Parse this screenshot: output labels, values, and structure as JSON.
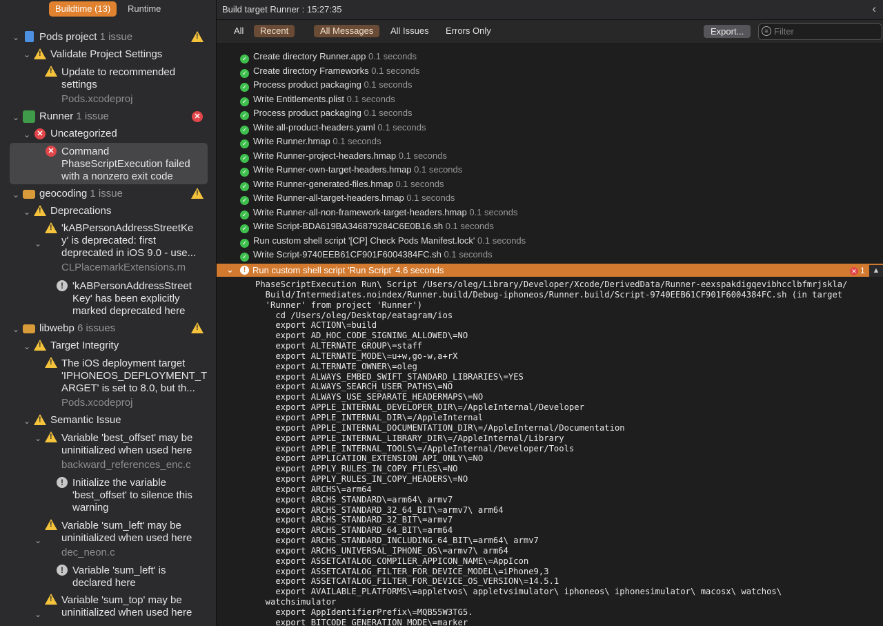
{
  "left_tabs": {
    "buildtime": "Buildtime (13)",
    "runtime": "Runtime"
  },
  "issues": {
    "pods_project": {
      "title": "Pods project",
      "count": "1 issue"
    },
    "validate_settings": "Validate Project Settings",
    "update_recommended": {
      "line1": "Update to recommended",
      "line2": "settings",
      "file": "Pods.xcodeproj"
    },
    "runner": {
      "title": "Runner",
      "count": "1 issue"
    },
    "uncategorized": "Uncategorized",
    "command_failed": {
      "line1": "Command",
      "line2": "PhaseScriptExecution failed",
      "line3": "with a nonzero exit code"
    },
    "geocoding": {
      "title": "geocoding",
      "count": "1 issue"
    },
    "deprecations": "Deprecations",
    "kab_deprecated": {
      "line1": "'kABPersonAddressStreetKe",
      "line2": "y' is deprecated: first",
      "line3": "deprecated in iOS 9.0 - use...",
      "file": "CLPlacemarkExtensions.m"
    },
    "kab_note": {
      "line1": "'kABPersonAddressStreet",
      "line2": "Key' has been explicitly",
      "line3": "marked deprecated here"
    },
    "libwebp": {
      "title": "libwebp",
      "count": "6 issues"
    },
    "target_integrity": "Target Integrity",
    "ios_deployment": {
      "line1": "The iOS deployment target",
      "line2": "'IPHONEOS_DEPLOYMENT_T",
      "line3": "ARGET' is set to 8.0, but th...",
      "file": "Pods.xcodeproj"
    },
    "semantic_issue": "Semantic Issue",
    "best_offset": {
      "line1": "Variable 'best_offset' may be",
      "line2": "uninitialized when used here",
      "file": "backward_references_enc.c"
    },
    "best_offset_note": {
      "line1": "Initialize the variable",
      "line2": "'best_offset' to silence this",
      "line3": "warning"
    },
    "sum_left": {
      "line1": "Variable 'sum_left' may be",
      "line2": "uninitialized when used here",
      "file": "dec_neon.c"
    },
    "sum_left_note": {
      "line1": "Variable 'sum_left' is",
      "line2": "declared here"
    },
    "sum_top": {
      "line1": "Variable 'sum_top' may be",
      "line2": "uninitialized when used here"
    }
  },
  "header": {
    "title": "Build target Runner : 15:27:35"
  },
  "toolbar": {
    "all": "All",
    "recent": "Recent",
    "all_messages": "All Messages",
    "all_issues": "All Issues",
    "errors_only": "Errors Only",
    "export": "Export...",
    "filter_placeholder": "Filter"
  },
  "log_rows": [
    {
      "text": "Create directory Runner.app",
      "dur": "0.1 seconds"
    },
    {
      "text": "Create directory Frameworks",
      "dur": "0.1 seconds"
    },
    {
      "text": "Process product packaging",
      "dur": "0.1 seconds"
    },
    {
      "text": "Write Entitlements.plist",
      "dur": "0.1 seconds"
    },
    {
      "text": "Process product packaging",
      "dur": "0.1 seconds"
    },
    {
      "text": "Write all-product-headers.yaml",
      "dur": "0.1 seconds"
    },
    {
      "text": "Write Runner.hmap",
      "dur": "0.1 seconds"
    },
    {
      "text": "Write Runner-project-headers.hmap",
      "dur": "0.1 seconds"
    },
    {
      "text": "Write Runner-own-target-headers.hmap",
      "dur": "0.1 seconds"
    },
    {
      "text": "Write Runner-generated-files.hmap",
      "dur": "0.1 seconds"
    },
    {
      "text": "Write Runner-all-target-headers.hmap",
      "dur": "0.1 seconds"
    },
    {
      "text": "Write Runner-all-non-framework-target-headers.hmap",
      "dur": "0.1 seconds"
    },
    {
      "text": "Write Script-BDA619BA346879284C6E0B16.sh",
      "dur": "0.1 seconds"
    },
    {
      "text": "Run custom shell script '[CP] Check Pods Manifest.lock'",
      "dur": "0.1 seconds"
    },
    {
      "text": "Write Script-9740EEB61CF901F6004384FC.sh",
      "dur": "0.1 seconds"
    }
  ],
  "failed_step": {
    "text": "Run custom shell script 'Run Script'  4.6 seconds",
    "badge": "1"
  },
  "console_lines": [
    "PhaseScriptExecution Run\\ Script /Users/oleg/Library/Developer/Xcode/DerivedData/Runner-eexspakdigqevibhcclbfmrjskla/",
    "  Build/Intermediates.noindex/Runner.build/Debug-iphoneos/Runner.build/Script-9740EEB61CF901F6004384FC.sh (in target",
    "  'Runner' from project 'Runner')",
    "    cd /Users/oleg/Desktop/eatagram/ios",
    "    export ACTION\\=build",
    "    export AD_HOC_CODE_SIGNING_ALLOWED\\=NO",
    "    export ALTERNATE_GROUP\\=staff",
    "    export ALTERNATE_MODE\\=u+w,go-w,a+rX",
    "    export ALTERNATE_OWNER\\=oleg",
    "    export ALWAYS_EMBED_SWIFT_STANDARD_LIBRARIES\\=YES",
    "    export ALWAYS_SEARCH_USER_PATHS\\=NO",
    "    export ALWAYS_USE_SEPARATE_HEADERMAPS\\=NO",
    "    export APPLE_INTERNAL_DEVELOPER_DIR\\=/AppleInternal/Developer",
    "    export APPLE_INTERNAL_DIR\\=/AppleInternal",
    "    export APPLE_INTERNAL_DOCUMENTATION_DIR\\=/AppleInternal/Documentation",
    "    export APPLE_INTERNAL_LIBRARY_DIR\\=/AppleInternal/Library",
    "    export APPLE_INTERNAL_TOOLS\\=/AppleInternal/Developer/Tools",
    "    export APPLICATION_EXTENSION_API_ONLY\\=NO",
    "    export APPLY_RULES_IN_COPY_FILES\\=NO",
    "    export APPLY_RULES_IN_COPY_HEADERS\\=NO",
    "    export ARCHS\\=arm64",
    "    export ARCHS_STANDARD\\=arm64\\ armv7",
    "    export ARCHS_STANDARD_32_64_BIT\\=armv7\\ arm64",
    "    export ARCHS_STANDARD_32_BIT\\=armv7",
    "    export ARCHS_STANDARD_64_BIT\\=arm64",
    "    export ARCHS_STANDARD_INCLUDING_64_BIT\\=arm64\\ armv7",
    "    export ARCHS_UNIVERSAL_IPHONE_OS\\=armv7\\ arm64",
    "    export ASSETCATALOG_COMPILER_APPICON_NAME\\=AppIcon",
    "    export ASSETCATALOG_FILTER_FOR_DEVICE_MODEL\\=iPhone9,3",
    "    export ASSETCATALOG_FILTER_FOR_DEVICE_OS_VERSION\\=14.5.1",
    "    export AVAILABLE_PLATFORMS\\=appletvos\\ appletvsimulator\\ iphoneos\\ iphonesimulator\\ macosx\\ watchos\\",
    "  watchsimulator",
    "    export AppIdentifierPrefix\\=MQB55W3TG5.",
    "    export BITCODE_GENERATION_MODE\\=marker"
  ]
}
